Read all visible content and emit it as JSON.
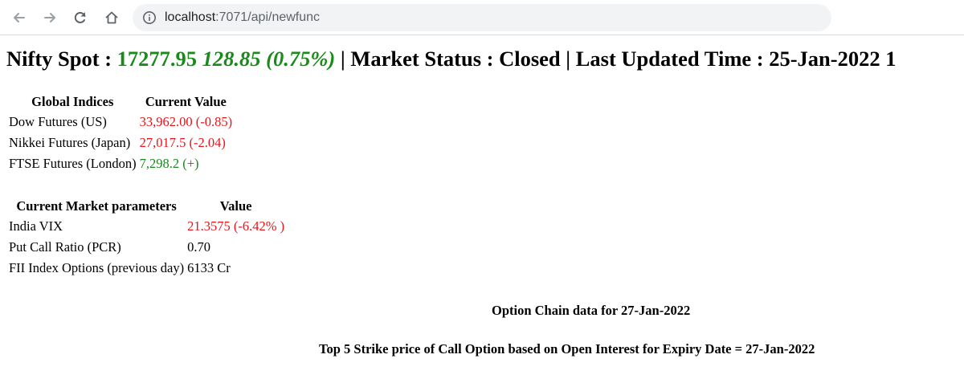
{
  "browser": {
    "url_host": "localhost",
    "url_path": ":7071/api/newfunc"
  },
  "header": {
    "spot_label": "Nifty Spot : ",
    "spot_value": "17277.95",
    "spot_change": "128.85 (0.75%)",
    "status_text": " | Market Status : Closed | Last Updated Time : 25-Jan-2022 1"
  },
  "global_indices": {
    "headers": [
      "Global Indices",
      "Current Value"
    ],
    "rows": [
      {
        "name": "Dow Futures (US)",
        "value": "33,962.00 (-0.85)",
        "trend": "down"
      },
      {
        "name": "Nikkei Futures (Japan)",
        "value": "27,017.5 (-2.04)",
        "trend": "down"
      },
      {
        "name": "FTSE Futures (London)",
        "value": "7,298.2 (+)",
        "trend": "up"
      }
    ]
  },
  "market_params": {
    "headers": [
      "Current Market parameters",
      "Value"
    ],
    "rows": [
      {
        "name": "India VIX",
        "value": "21.3575 (-6.42% )",
        "trend": "down"
      },
      {
        "name": "Put Call Ratio (PCR)",
        "value": "0.70",
        "trend": "neutral"
      },
      {
        "name": "FII Index Options (previous day)",
        "value": "6133 Cr",
        "trend": "neutral"
      }
    ]
  },
  "option_chain": {
    "title": "Option Chain data for 27-Jan-2022",
    "subtitle": "Top 5 Strike price of Call Option based on Open Interest for Expiry Date = 27-Jan-2022"
  },
  "colors": {
    "up": "#1a8a1a",
    "down": "#e8141a",
    "neutral": "#000000"
  }
}
